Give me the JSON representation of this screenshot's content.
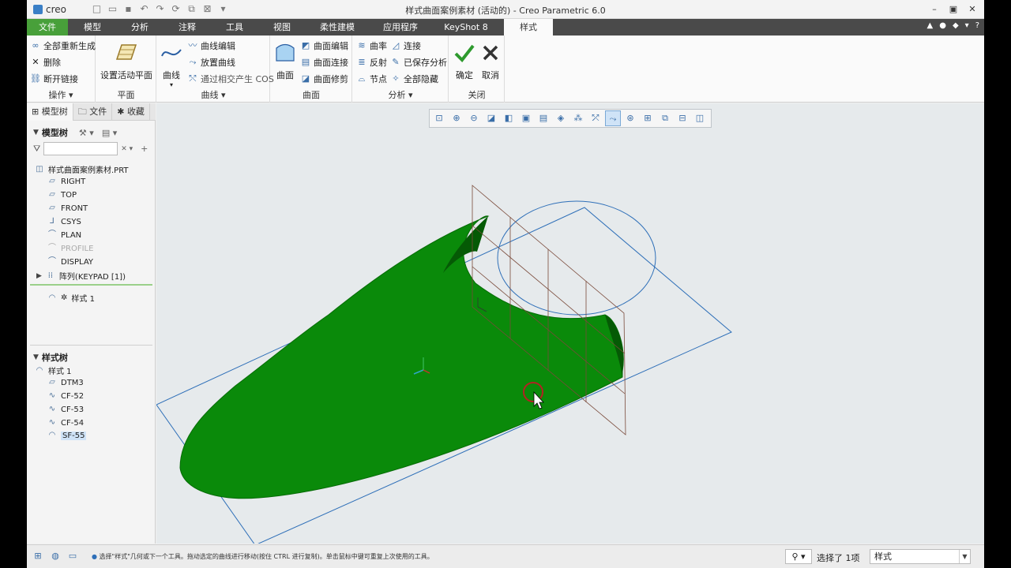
{
  "app": {
    "logo": "creo",
    "title": "样式曲面案例素材 (活动的) - Creo Parametric 6.0"
  },
  "window_controls": [
    "–",
    "▣",
    "✕"
  ],
  "ribbon_tabs": [
    "文件",
    "模型",
    "分析",
    "注释",
    "工具",
    "视图",
    "柔性建模",
    "应用程序",
    "KeyShot 8",
    "样式"
  ],
  "active_tab": "样式",
  "ribbon": {
    "ops": {
      "label": "操作",
      "regen": "全部重新生成",
      "delete": "删除",
      "break_link": "断开链接"
    },
    "plane": {
      "label": "平面",
      "set_active": "设置活动平面"
    },
    "curve": {
      "label": "曲线",
      "curve": "曲线",
      "edit": "曲线编辑",
      "place": "放置曲线",
      "cos": "通过相交产生 COS"
    },
    "surface": {
      "label": "曲面",
      "surface": "曲面",
      "edit": "曲面编辑",
      "connect": "曲面连接",
      "trim": "曲面修剪"
    },
    "analysis": {
      "label": "分析",
      "curvature": "曲率",
      "connect": "连接",
      "reflect": "反射",
      "saved": "已保存分析",
      "node": "节点",
      "hide_all": "全部隐藏"
    },
    "close": {
      "label": "关闭",
      "ok": "确定",
      "cancel": "取消"
    }
  },
  "panel_tabs": [
    "模型树",
    "文件",
    "收藏"
  ],
  "model_tree": {
    "title": "模型树",
    "root": "样式曲面案例素材.PRT",
    "items": [
      "RIGHT",
      "TOP",
      "FRONT",
      "CSYS",
      "PLAN",
      "PROFILE",
      "DISPLAY",
      "阵列(KEYPAD [1])"
    ],
    "feature": "样式 1"
  },
  "style_tree": {
    "title": "样式树",
    "root": "样式 1",
    "items": [
      "DTM3",
      "CF-52",
      "CF-53",
      "CF-54",
      "SF-55"
    ]
  },
  "status": {
    "message": "选择\"样式\"几何或下一个工具。拖动选定的曲线进行移动(按住 CTRL 进行复制)。单击鼠标中键可重复上次使用的工具。",
    "selected": "选择了 1项",
    "filter": "样式"
  },
  "colors": {
    "surface": "#0a8a0a",
    "file_tab": "#48a03a",
    "tabbar": "#4a4a4a",
    "viewport_bg": "#e6eaec",
    "datum_plane": "#2e6fb8",
    "grid_plane": "#7a4a3a",
    "cursor_ring": "#b22222"
  }
}
